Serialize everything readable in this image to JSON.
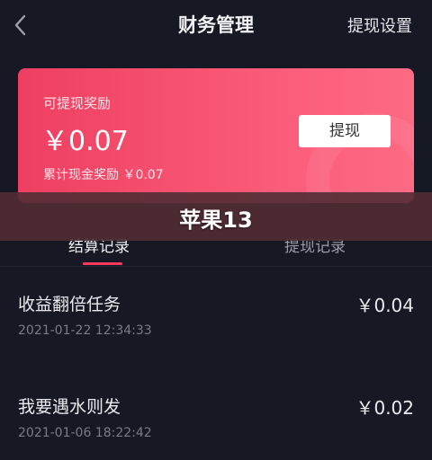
{
  "header": {
    "title": "财务管理",
    "settings_label": "提现设置",
    "back_icon": "chevron-left-icon"
  },
  "card": {
    "label": "可提现奖励",
    "amount": "￥0.07",
    "cumulative": "累计现金奖励 ￥0.07",
    "withdraw_label": "提现",
    "gradient_start": "#ee3f61",
    "gradient_end": "#fd6a84"
  },
  "tabs": [
    {
      "label": "结算记录",
      "active": true
    },
    {
      "label": "提现记录",
      "active": false
    }
  ],
  "overlay": {
    "text": "苹果13"
  },
  "records": [
    {
      "name": "收益翻倍任务",
      "date": "2021-01-22 12:34:33",
      "amount": "￥0.04"
    },
    {
      "name": "我要遇水则发",
      "date": "2021-01-06 18:22:42",
      "amount": "￥0.02"
    }
  ],
  "colors": {
    "background": "#161824",
    "accent": "#fd3a5c"
  }
}
